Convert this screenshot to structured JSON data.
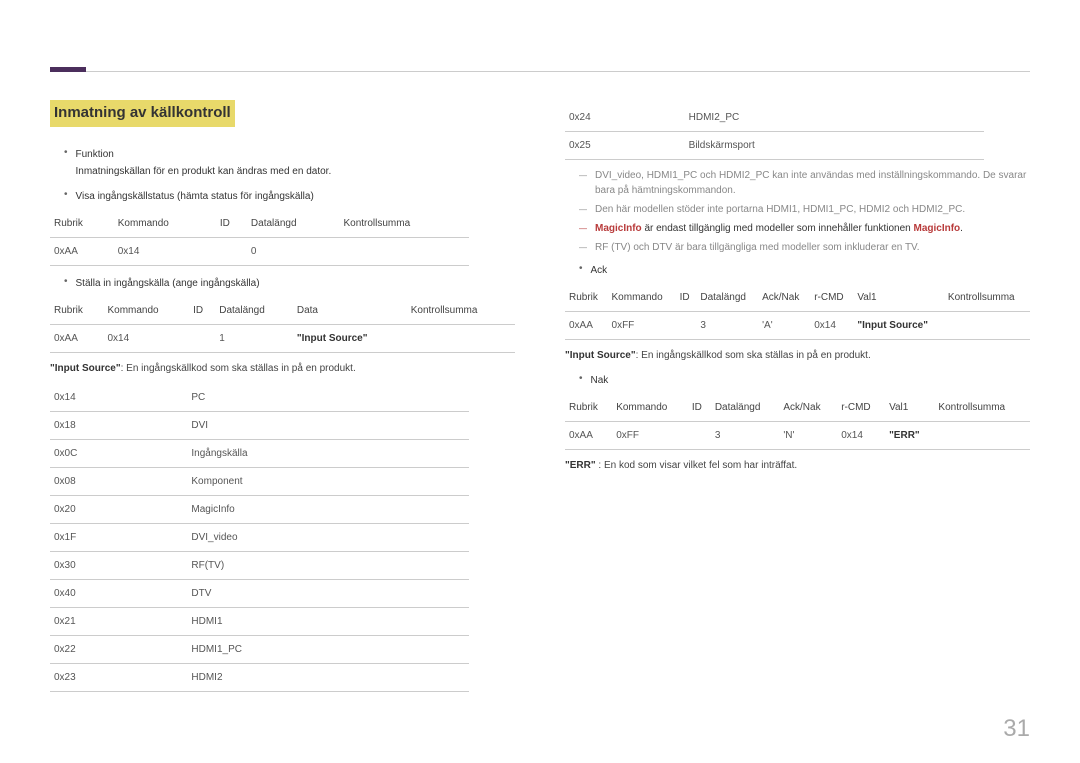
{
  "section_title": "Inmatning av källkontroll",
  "left": {
    "b1": {
      "title": "Funktion",
      "desc": "Inmatningskällan för en produkt kan ändras med en dator."
    },
    "b2": {
      "title": "Visa ingångskällstatus (hämta status för ingångskälla)"
    },
    "t1": {
      "h": [
        "Rubrik",
        "Kommando",
        "ID",
        "Datalängd",
        "Kontrollsumma"
      ],
      "r": [
        "0xAA",
        "0x14",
        "",
        "0",
        ""
      ]
    },
    "b3": {
      "title": "Ställa in ingångskälla (ange ingångskälla)"
    },
    "t2": {
      "h": [
        "Rubrik",
        "Kommando",
        "ID",
        "Datalängd",
        "Data",
        "Kontrollsumma"
      ],
      "r": [
        "0xAA",
        "0x14",
        "",
        "1",
        "\"Input Source\"",
        ""
      ]
    },
    "p1_pre": "\"Input Source\"",
    "p1_post": ": En ingångskällkod som ska ställas in på en produkt.",
    "codes": [
      [
        "0x14",
        "PC"
      ],
      [
        "0x18",
        "DVI"
      ],
      [
        "0x0C",
        "Ingångskälla"
      ],
      [
        "0x08",
        "Komponent"
      ],
      [
        "0x20",
        "MagicInfo"
      ],
      [
        "0x1F",
        "DVI_video"
      ],
      [
        "0x30",
        "RF(TV)"
      ],
      [
        "0x40",
        "DTV"
      ],
      [
        "0x21",
        "HDMI1"
      ],
      [
        "0x22",
        "HDMI1_PC"
      ],
      [
        "0x23",
        "HDMI2"
      ]
    ]
  },
  "right": {
    "codes2": [
      [
        "0x24",
        "HDMI2_PC"
      ],
      [
        "0x25",
        "Bildskärmsport"
      ]
    ],
    "d1": "DVI_video, HDMI1_PC och HDMI2_PC kan inte användas med inställningskommando. De svarar bara på hämtningskommandon.",
    "d2": "Den här modellen stöder inte portarna HDMI1, HDMI1_PC, HDMI2 och HDMI2_PC.",
    "d3_pre": "MagicInfo",
    "d3_mid": " är endast tillgänglig med modeller som innehåller funktionen ",
    "d3_post": "MagicInfo",
    "d4": "RF (TV) och DTV är bara tillgängliga med modeller som inkluderar en TV.",
    "ack_label": "Ack",
    "tack": {
      "h": [
        "Rubrik",
        "Kommando",
        "ID",
        "Datalängd",
        "Ack/Nak",
        "r-CMD",
        "Val1",
        "Kontrollsumma"
      ],
      "r": [
        "0xAA",
        "0xFF",
        "",
        "3",
        "'A'",
        "0x14",
        "\"Input Source\"",
        ""
      ]
    },
    "p2_pre": "\"Input Source\"",
    "p2_post": ": En ingångskällkod som ska ställas in på en produkt.",
    "nak_label": "Nak",
    "tnak": {
      "h": [
        "Rubrik",
        "Kommando",
        "ID",
        "Datalängd",
        "Ack/Nak",
        "r-CMD",
        "Val1",
        "Kontrollsumma"
      ],
      "r": [
        "0xAA",
        "0xFF",
        "",
        "3",
        "'N'",
        "0x14",
        "\"ERR\"",
        ""
      ]
    },
    "p3_pre": "\"ERR\"",
    "p3_post": " : En kod som visar vilket fel som har inträffat."
  },
  "page_number": "31"
}
